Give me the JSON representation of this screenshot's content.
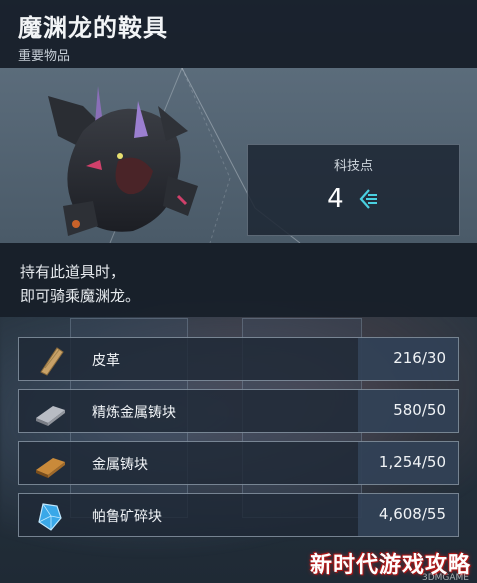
{
  "item": {
    "title": "魔渊龙的鞍具",
    "category": "重要物品"
  },
  "tech": {
    "label": "科技点",
    "value": "4",
    "icon": "tech-point-icon"
  },
  "description": {
    "line1": "持有此道具时，",
    "line2": "即可骑乘魔渊龙。"
  },
  "materials": [
    {
      "name": "皮革",
      "count": "216/30",
      "icon": "leather-icon"
    },
    {
      "name": "精炼金属铸块",
      "count": "580/50",
      "icon": "refined-ingot-icon"
    },
    {
      "name": "金属铸块",
      "count": "1,254/50",
      "icon": "ingot-icon"
    },
    {
      "name": "帕鲁矿碎块",
      "count": "4,608/55",
      "icon": "pal-crystal-icon"
    }
  ],
  "watermark": {
    "text": "新时代游戏攻略",
    "small": "3DMGAME"
  }
}
